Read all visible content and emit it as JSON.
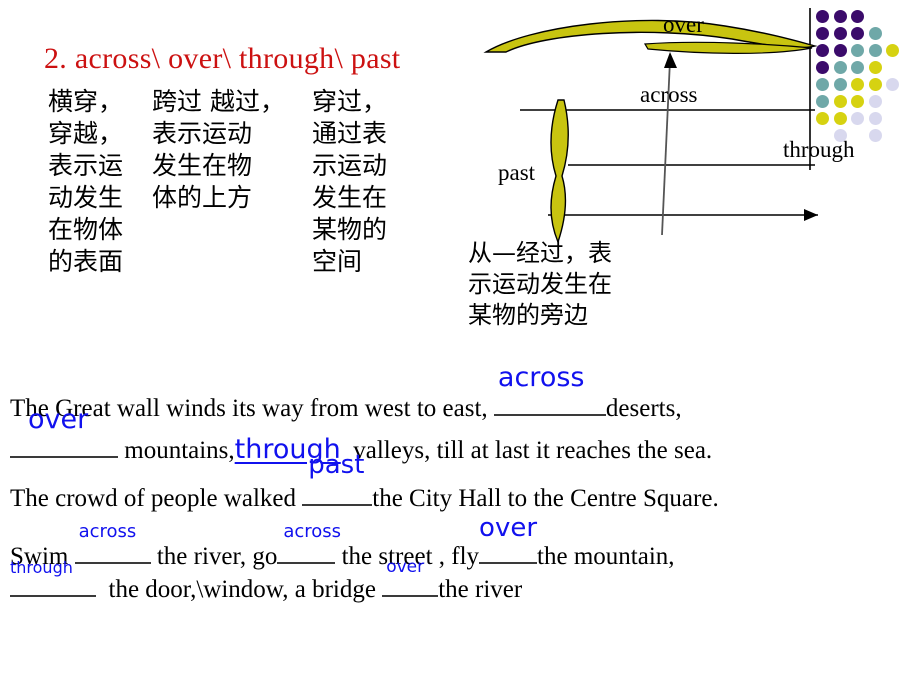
{
  "slide": {
    "title": "2. across\\ over\\ through\\ past",
    "title_color": "#CC1111",
    "answer_color": "#1111EE",
    "ribbon_color": "#C8C410"
  },
  "glosses": [
    {
      "key": "across",
      "text": "横穿，\n穿越，\n表示运\n动发生\n在物体\n的表面"
    },
    {
      "key": "over",
      "text": "跨过 越过，\n表示运动\n发生在物\n体的上方"
    },
    {
      "key": "through",
      "text": "穿过，\n通过表\n示运动\n发生在\n某物的\n空间"
    },
    {
      "key": "past",
      "text": "从—经过，表\n示运动发生在\n某物的旁边"
    }
  ],
  "diagram": {
    "labels": {
      "over": "over",
      "across": "across",
      "past": "past",
      "through": "through"
    },
    "dot_grid": {
      "colors": {
        "purple": "#3B0B6B",
        "teal": "#6FA8A8",
        "yellow": "#D6D211",
        "lavender": "#D8D8EE"
      },
      "rows": [
        [
          "purple",
          "purple",
          "purple"
        ],
        [
          "purple",
          "purple",
          "purple",
          "teal"
        ],
        [
          "purple",
          "purple",
          "teal",
          "teal",
          "yellow"
        ],
        [
          "purple",
          "teal",
          "teal",
          "yellow"
        ],
        [
          "teal",
          "teal",
          "yellow",
          "yellow",
          "lavender"
        ],
        [
          "teal",
          "yellow",
          "yellow",
          "lavender"
        ],
        [
          "yellow",
          "yellow",
          "lavender",
          "lavender"
        ],
        [
          null,
          "lavender",
          null,
          "lavender"
        ]
      ]
    }
  },
  "sentences": {
    "s1": {
      "p1": "The Great wall winds its way from west to east,",
      "blank1": "across",
      "p2": "deserts,"
    },
    "s2": {
      "blank1": "over",
      "p1": "mountains,",
      "blank2": "through",
      "p2": "valleys, till at last it reaches the sea."
    },
    "s3": {
      "p1": "The crowd of people walked",
      "blank1": "past",
      "p2": "the City Hall to the Centre Square."
    },
    "s4": {
      "p1": "Swim",
      "blank1": "across",
      "p2": "the river, go",
      "blank2": "across",
      "p3": "the street , fly",
      "blank3": "over",
      "p4": "the mountain,"
    },
    "s5": {
      "blank1": "through",
      "p1": "the door,\\window, a bridge",
      "blank2": "over",
      "p2": "the river"
    }
  }
}
